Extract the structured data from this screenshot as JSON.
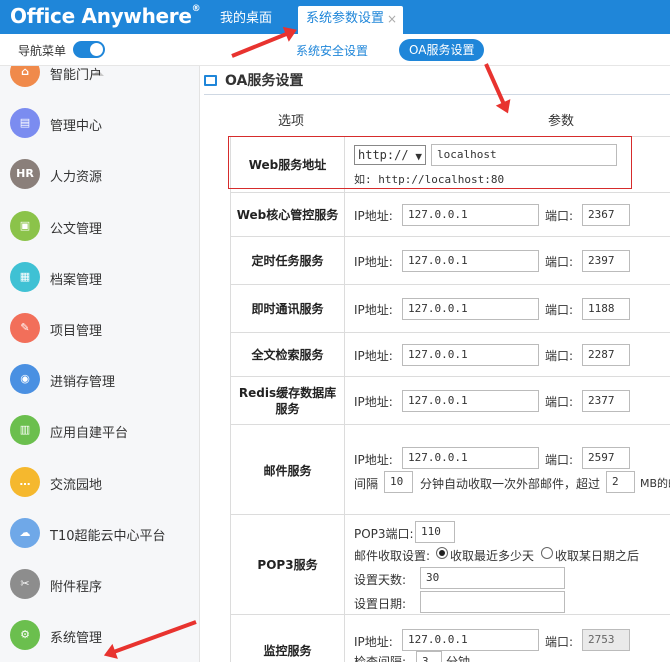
{
  "app": {
    "logo": "Office Anywhere",
    "logo_mark": "®"
  },
  "tabs": [
    {
      "label": "我的桌面"
    },
    {
      "label": "系统参数设置",
      "close": "×"
    }
  ],
  "subbar": {
    "nav_label": "导航菜单",
    "subtabs": [
      {
        "label": "系统安全设置"
      },
      {
        "label": "OA服务设置"
      }
    ]
  },
  "sidebar": {
    "items": [
      {
        "label": "智能门户",
        "icon": "portal-icon",
        "color": "#f08a4b",
        "glyph": "⌂"
      },
      {
        "label": "管理中心",
        "icon": "document-icon",
        "color": "#7b8cf0",
        "glyph": "▤"
      },
      {
        "label": "人力资源",
        "icon": "hr-icon",
        "color": "#8a7f7a",
        "glyph": "HR"
      },
      {
        "label": "公文管理",
        "icon": "briefcase-icon",
        "color": "#8bc34a",
        "glyph": "▣"
      },
      {
        "label": "档案管理",
        "icon": "archive-icon",
        "color": "#3fc1d4",
        "glyph": "▦"
      },
      {
        "label": "项目管理",
        "icon": "project-icon",
        "color": "#f26f5a",
        "glyph": "✎"
      },
      {
        "label": "进销存管理",
        "icon": "inventory-icon",
        "color": "#4a90e2",
        "glyph": "◉"
      },
      {
        "label": "应用自建平台",
        "icon": "chart-icon",
        "color": "#6bbf4e",
        "glyph": "▥"
      },
      {
        "label": "交流园地",
        "icon": "chat-icon",
        "color": "#f5b82e",
        "glyph": "…"
      },
      {
        "label": "T10超能云中心平台",
        "icon": "cloud-icon",
        "color": "#6fa8e8",
        "glyph": "☁"
      },
      {
        "label": "附件程序",
        "icon": "paperclip-icon",
        "color": "#8d8d8d",
        "glyph": "✂"
      },
      {
        "label": "系统管理",
        "icon": "gear-icon",
        "color": "#6bbf4e",
        "glyph": "⚙"
      }
    ]
  },
  "main": {
    "title": "OA服务设置",
    "col_option": "选项",
    "col_param": "参数",
    "web": {
      "name": "Web服务地址",
      "protocol": "http://",
      "host": "localhost",
      "example": "如: http://localhost:80"
    },
    "ip_label": "IP地址:",
    "port_label": "端口:",
    "services": [
      {
        "name": "Web核心管控服务",
        "ip": "127.0.0.1",
        "port": "2367"
      },
      {
        "name": "定时任务服务",
        "ip": "127.0.0.1",
        "port": "2397"
      },
      {
        "name": "即时通讯服务",
        "ip": "127.0.0.1",
        "port": "1188"
      },
      {
        "name": "全文检索服务",
        "ip": "127.0.0.1",
        "port": "2287"
      },
      {
        "name": "Redis缓存数据库服务",
        "ip": "127.0.0.1",
        "port": "2377"
      }
    ],
    "mail": {
      "name": "邮件服务",
      "ip": "127.0.0.1",
      "port": "2597",
      "interval_label": "间隔",
      "interval": "10",
      "interval_text": "分钟自动收取一次外部邮件，超过",
      "size": "2",
      "size_text": "MB的邮"
    },
    "pop3": {
      "name": "POP3服务",
      "port_label": "POP3端口:",
      "port": "110",
      "recv_label": "邮件收取设置:",
      "opt1": "收取最近多少天",
      "opt2": "收取某日期之后",
      "days_label": "设置天数:",
      "days": "30",
      "date_label": "设置日期:",
      "date": ""
    },
    "monitor": {
      "name": "监控服务",
      "ip": "127.0.0.1",
      "port": "2753",
      "interval_label": "检查间隔:",
      "interval": "3",
      "unit": "分钟"
    }
  }
}
